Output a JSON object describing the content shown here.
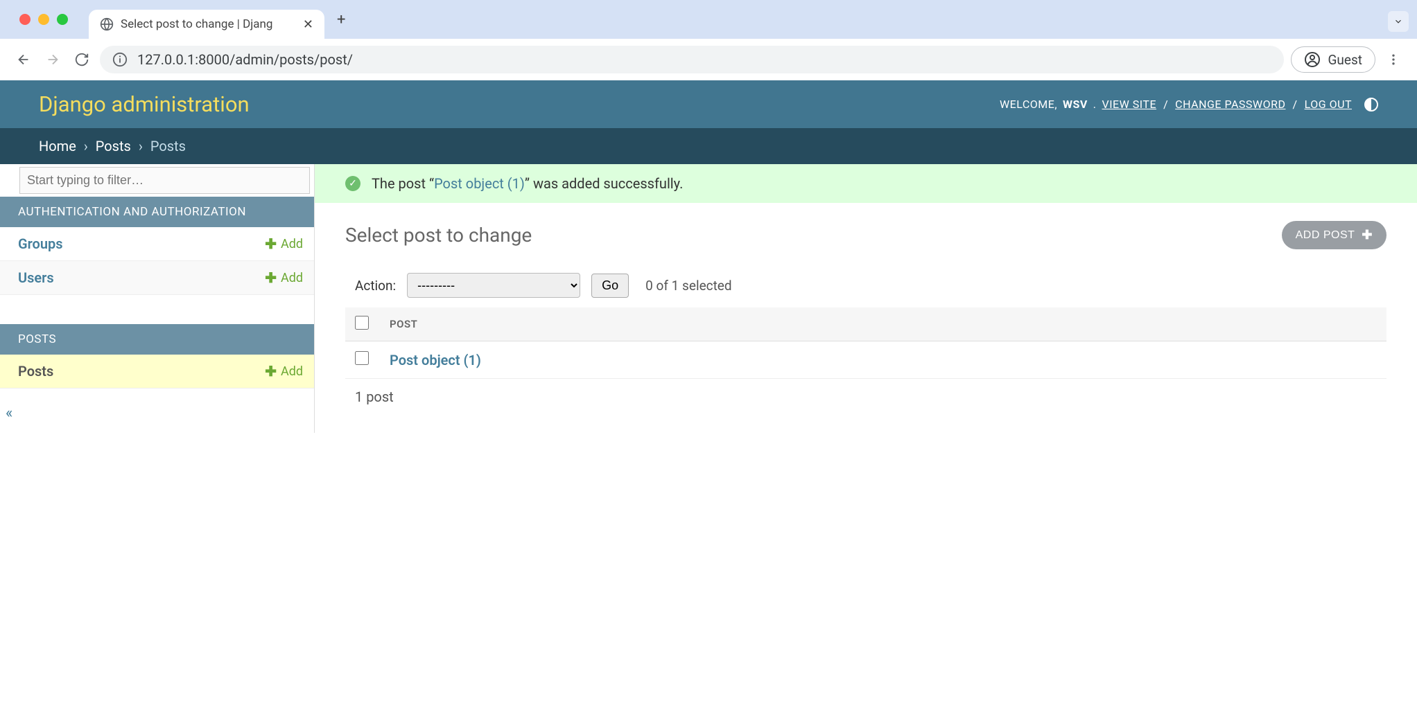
{
  "browser": {
    "tab_title": "Select post to change | Djang",
    "url": "127.0.0.1:8000/admin/posts/post/",
    "guest_label": "Guest"
  },
  "header": {
    "title": "Django administration",
    "welcome": "WELCOME,",
    "username": "WSV",
    "view_site": "VIEW SITE",
    "change_password": "CHANGE PASSWORD",
    "log_out": "LOG OUT"
  },
  "breadcrumbs": {
    "home": "Home",
    "section": "Posts",
    "current": "Posts"
  },
  "sidebar": {
    "filter_placeholder": "Start typing to filter…",
    "sections": [
      {
        "heading": "AUTHENTICATION AND AUTHORIZATION",
        "items": [
          {
            "label": "Groups",
            "add": "Add"
          },
          {
            "label": "Users",
            "add": "Add"
          }
        ]
      },
      {
        "heading": "POSTS",
        "items": [
          {
            "label": "Posts",
            "add": "Add",
            "active": true
          }
        ]
      }
    ]
  },
  "message": {
    "prefix": "The post “",
    "object": "Post object (1)",
    "suffix": "” was added successfully."
  },
  "content": {
    "page_title": "Select post to change",
    "add_button": "ADD POST",
    "action_label": "Action:",
    "action_placeholder": "---------",
    "go_label": "Go",
    "selection_count": "0 of 1 selected",
    "column_header": "POST",
    "rows": [
      {
        "label": "Post object (1)"
      }
    ],
    "count_text": "1 post"
  }
}
